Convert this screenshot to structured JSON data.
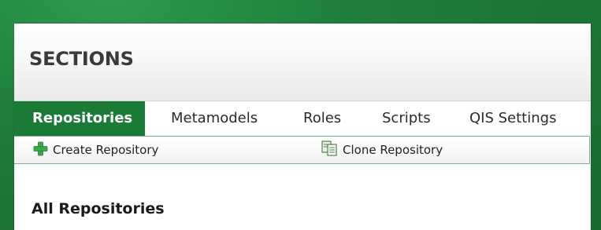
{
  "panel": {
    "title": "SECTIONS"
  },
  "tabs": [
    {
      "label": "Repositories",
      "active": true
    },
    {
      "label": "Metamodels",
      "active": false
    },
    {
      "label": "Roles",
      "active": false
    },
    {
      "label": "Scripts",
      "active": false
    },
    {
      "label": "QIS Settings",
      "active": false
    }
  ],
  "toolbar": {
    "create_label": "Create Repository",
    "create_icon": "plus-icon",
    "clone_label": "Clone Repository",
    "clone_icon": "clone-icon"
  },
  "content": {
    "heading": "All Repositories"
  },
  "colors": {
    "accent": "#1c7a37",
    "frame": "#176a30",
    "plus": "#3aa74a"
  }
}
